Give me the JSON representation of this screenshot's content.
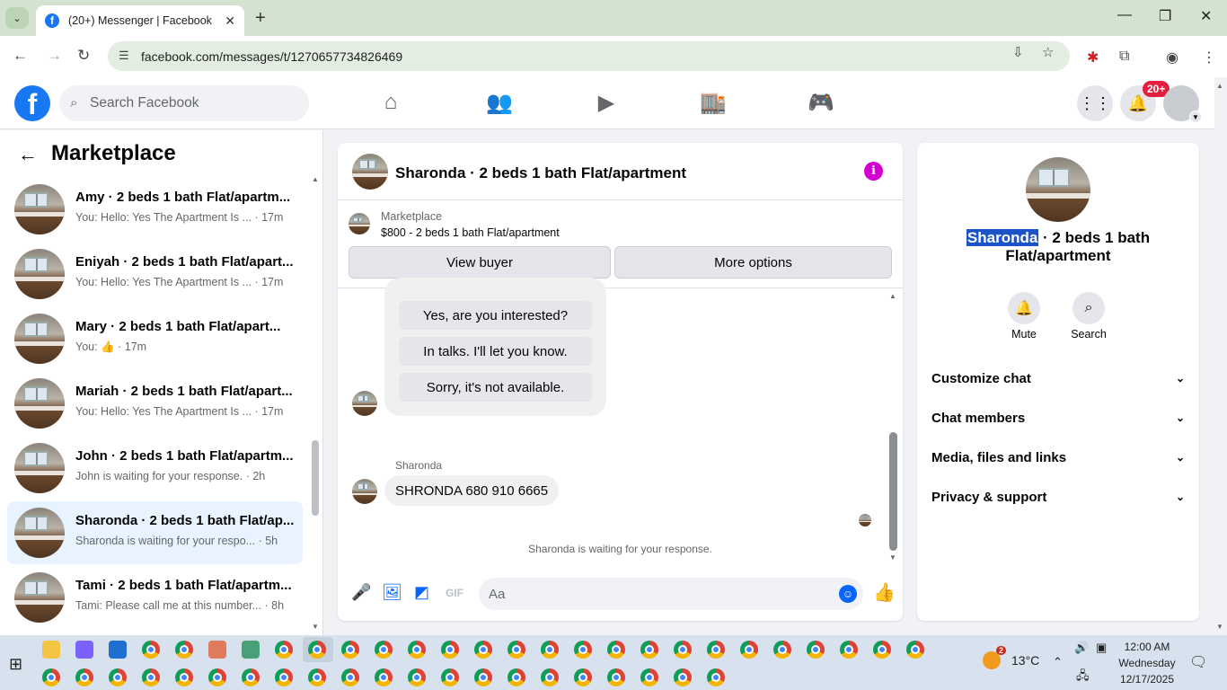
{
  "browser": {
    "tab_title": "(20+) Messenger | Facebook",
    "url": "facebook.com/messages/t/1270657734826469"
  },
  "fb_header": {
    "search_placeholder": "Search Facebook",
    "notification_count": "20+",
    "nav_icons": [
      "home-icon",
      "friends-icon",
      "watch-icon",
      "marketplace-icon",
      "gaming-icon"
    ]
  },
  "sidebar": {
    "title": "Marketplace",
    "conversations": [
      {
        "title": "Amy · 2 beds 1 bath Flat/apartm...",
        "preview": "You: Hello: Yes The Apartment Is ...",
        "time": "· 17m",
        "active": false
      },
      {
        "title": "Eniyah · 2 beds 1 bath Flat/apart...",
        "preview": "You: Hello: Yes The Apartment Is ...",
        "time": "· 17m",
        "active": false
      },
      {
        "title": "Mary · 2 beds 1 bath Flat/apart...",
        "preview": "You:",
        "time": "· 17m",
        "active": false
      },
      {
        "title": "Mariah · 2 beds 1 bath Flat/apart...",
        "preview": "You: Hello: Yes The Apartment Is ...",
        "time": "· 17m",
        "active": false
      },
      {
        "title": "John · 2 beds 1 bath Flat/apartm...",
        "preview": "John is waiting for your response.",
        "time": "· 2h",
        "active": false
      },
      {
        "title": "Sharonda · 2 beds 1 bath Flat/ap...",
        "preview": "Sharonda is waiting for your respo...",
        "time": "· 5h",
        "active": true
      },
      {
        "title": "Tami · 2 beds 1 bath Flat/apartm...",
        "preview": "Tami: Please call me at this number...",
        "time": "· 8h",
        "active": false
      }
    ]
  },
  "chat": {
    "title": "Sharonda · 2 beds 1 bath Flat/apartment",
    "marketplace_label": "Marketplace",
    "listing": "$800 - 2 beds 1 bath Flat/apartment",
    "view_buyer": "View buyer",
    "more_options": "More options",
    "quick_replies": [
      "Yes, are you interested?",
      "In talks. I'll let you know.",
      "Sorry, it's not available."
    ],
    "sender": "Sharonda",
    "message": "SHRONDA 680 910 6665",
    "waiting": "Sharonda is waiting for your response.",
    "composer_placeholder": "Aa"
  },
  "right_panel": {
    "name_highlight": "Sharonda",
    "name_rest": " · 2 beds 1 bath Flat/apartment",
    "actions": [
      {
        "label": "Mute",
        "icon": "bell-icon"
      },
      {
        "label": "Search",
        "icon": "search-icon"
      }
    ],
    "sections": [
      "Customize chat",
      "Chat members",
      "Media, files and links",
      "Privacy & support"
    ]
  },
  "taskbar": {
    "temperature": "13°C",
    "weather_badge": "2",
    "time": "12:00 AM",
    "day": "Wednesday",
    "date": "12/17/2025"
  }
}
